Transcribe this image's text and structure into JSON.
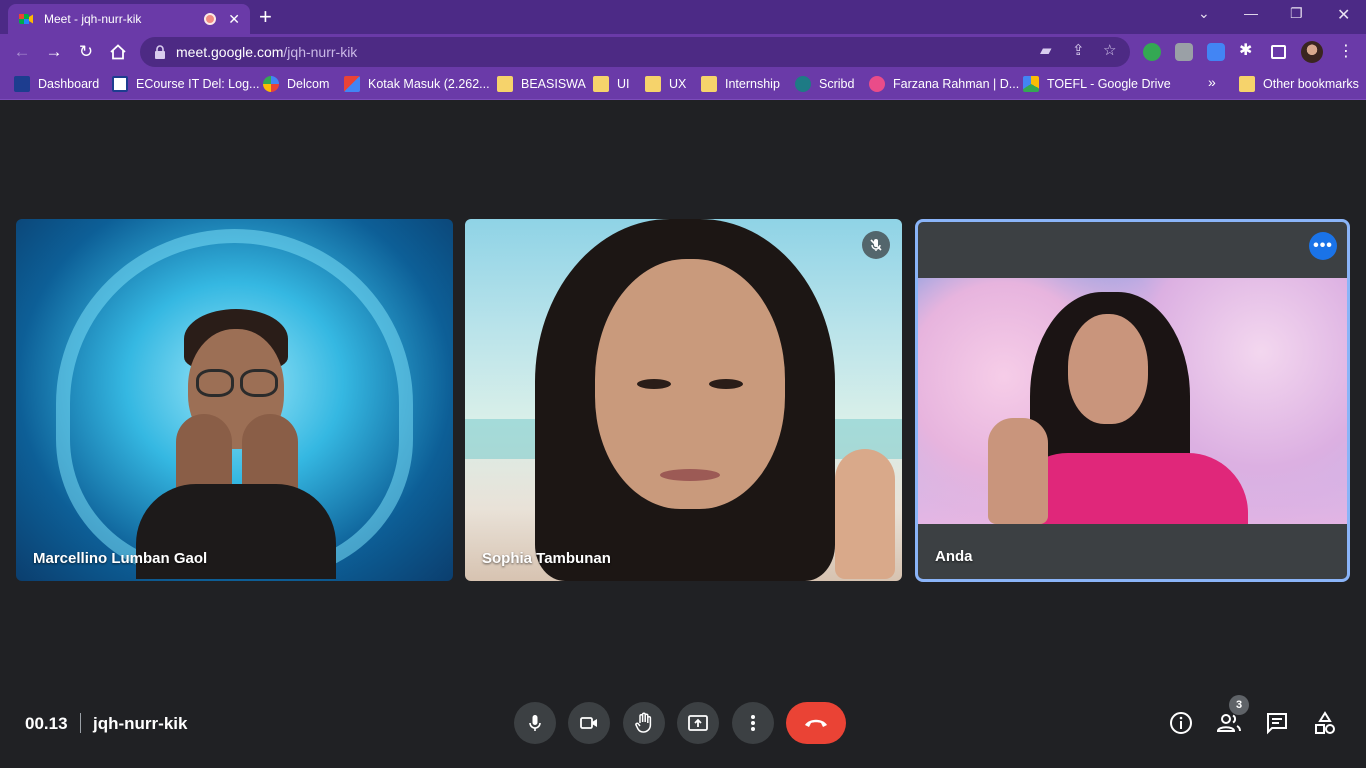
{
  "browser": {
    "tab_title": "Meet - jqh-nurr-kik",
    "url_host": "meet.google.com",
    "url_path": "/jqh-nurr-kik",
    "bookmarks": [
      {
        "label": "Dashboard",
        "icon": "del-icon"
      },
      {
        "label": "ECourse IT Del: Log...",
        "icon": "ecourse-icon"
      },
      {
        "label": "Delcom",
        "icon": "delcom-icon"
      },
      {
        "label": "Kotak Masuk (2.262...",
        "icon": "gmail-icon"
      },
      {
        "label": "BEASISWA",
        "icon": "folder-icon"
      },
      {
        "label": "UI",
        "icon": "folder-icon"
      },
      {
        "label": "UX",
        "icon": "folder-icon"
      },
      {
        "label": "Internship",
        "icon": "folder-icon"
      },
      {
        "label": "Scribd",
        "icon": "scribd-icon"
      },
      {
        "label": "Farzana Rahman | D...",
        "icon": "dribbble-icon"
      },
      {
        "label": "TOEFL - Google Drive",
        "icon": "drive-icon"
      }
    ],
    "overflow_label": "»",
    "other_bookmarks": "Other bookmarks"
  },
  "meeting": {
    "time": "00.13",
    "code": "jqh-nurr-kik",
    "participants_count": "3",
    "tiles": [
      {
        "name": "Marcellino Lumban Gaol"
      },
      {
        "name": "Sophia Tambunan",
        "muted": true
      },
      {
        "name": "Anda",
        "self": true
      }
    ]
  },
  "colors": {
    "chrome_dark": "#4c2a86",
    "chrome": "#6a3aa8",
    "meet_bg": "#202124",
    "control_bg": "#3c4043",
    "leave_red": "#ea4335",
    "active_border": "#8ab4f8"
  }
}
